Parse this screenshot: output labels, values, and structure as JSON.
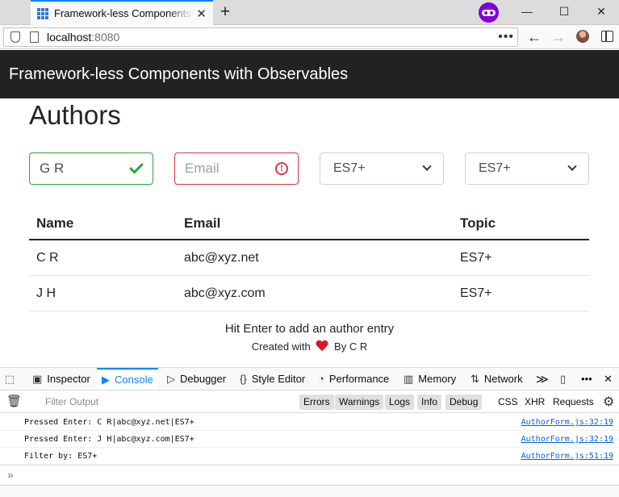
{
  "browser": {
    "tab_title": "Framework-less Components with Observables",
    "new_tab_symbol": "+",
    "tab_close_symbol": "✕",
    "window_controls": {
      "minimize": "—",
      "maximize": "☐",
      "close": "✕"
    },
    "url_host": "localhost",
    "url_port": ":8080",
    "url_more": "•••",
    "back_symbol": "←",
    "forward_symbol": "→",
    "accent_color": "#0a84ff",
    "private_color": "#8000d7"
  },
  "app": {
    "header_title": "Framework-less Components with Observables",
    "page_title": "Authors",
    "form": {
      "name_value": "G R",
      "email_placeholder": "Email",
      "topic_select_value": "ES7+",
      "filter_select_value": "ES7+",
      "valid_color": "#28a745",
      "invalid_color": "#dc3545",
      "alert_symbol": "!"
    },
    "table": {
      "headers": [
        "Name",
        "Email",
        "Topic"
      ],
      "rows": [
        [
          "C R",
          "abc@xyz.net",
          "ES7+"
        ],
        [
          "J H",
          "abc@xyz.com",
          "ES7+"
        ]
      ]
    },
    "hint": "Hit Enter to add an author entry",
    "credit_prefix": "Created with",
    "credit_suffix": "By C R"
  },
  "devtools": {
    "tabs": [
      {
        "label": "Inspector",
        "icon": "inspector-icon"
      },
      {
        "label": "Console",
        "icon": "console-icon",
        "active": true
      },
      {
        "label": "Debugger",
        "icon": "debugger-icon"
      },
      {
        "label": "Style Editor",
        "icon": "style-editor-icon"
      },
      {
        "label": "Performance",
        "icon": "performance-icon"
      },
      {
        "label": "Memory",
        "icon": "memory-icon"
      },
      {
        "label": "Network",
        "icon": "network-icon"
      }
    ],
    "overflow_symbol": "≫",
    "more_symbol": "•••",
    "close_symbol": "✕",
    "filter_placeholder": "Filter Output",
    "log_levels": [
      "Errors",
      "Warnings",
      "Logs",
      "Info",
      "Debug"
    ],
    "request_filters": [
      "CSS",
      "XHR",
      "Requests"
    ],
    "messages": [
      {
        "text": "Pressed Enter: C R|abc@xyz.net|ES7+",
        "source": "AuthorForm.js:32:19"
      },
      {
        "text": "Pressed Enter: J H|abc@xyz.com|ES7+",
        "source": "AuthorForm.js:32:19"
      },
      {
        "text": "Filter by: ES7+",
        "source": "AuthorForm.js:51:19"
      }
    ],
    "prompt_symbol": "»"
  }
}
